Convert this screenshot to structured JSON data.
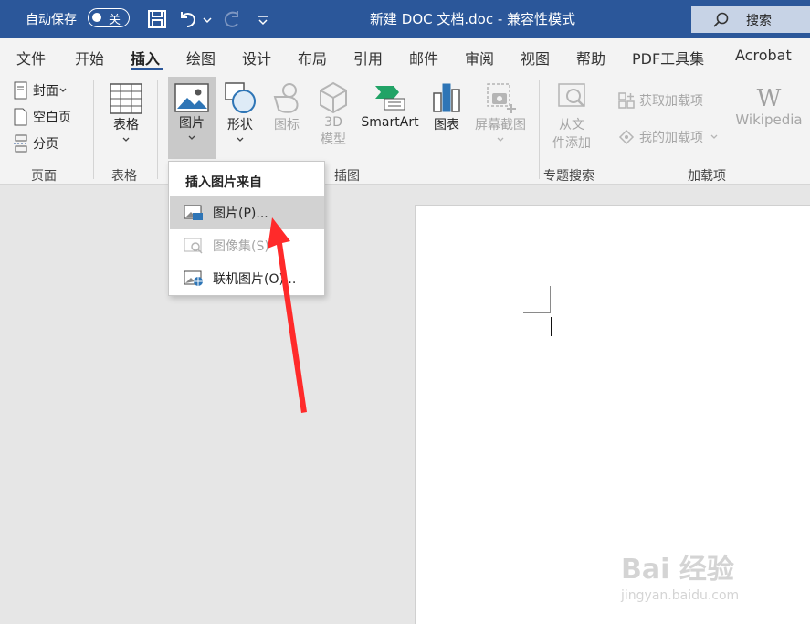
{
  "titlebar": {
    "autosave_label": "自动保存",
    "autosave_state": "关",
    "doc_title": "新建 DOC 文档.doc  -  兼容性模式",
    "search_label": "搜索"
  },
  "tabs": [
    "文件",
    "开始",
    "插入",
    "绘图",
    "设计",
    "布局",
    "引用",
    "邮件",
    "审阅",
    "视图",
    "帮助",
    "PDF工具集",
    "Acrobat"
  ],
  "active_tab": "插入",
  "ribbon": {
    "pages": {
      "cover": "封面",
      "blank": "空白页",
      "break": "分页",
      "group": "页面"
    },
    "table": {
      "label": "表格",
      "group": "表格"
    },
    "illustrations": {
      "picture": "图片",
      "shapes": "形状",
      "icons": "图标",
      "models3d_line1": "3D",
      "models3d_line2": "模型",
      "smartart": "SmartArt",
      "chart": "图表",
      "screenshot": "屏幕截图",
      "group": "插图"
    },
    "topic_search": {
      "line1": "从文",
      "line2": "件添加",
      "group": "专题搜索"
    },
    "addins": {
      "get": "获取加载项",
      "mine": "我的加载项",
      "wikipedia": "Wikipedia",
      "group": "加载项"
    }
  },
  "dropdown": {
    "header": "插入图片来自",
    "items": [
      {
        "label": "图片(P)...",
        "enabled": true
      },
      {
        "label": "图像集(S)",
        "enabled": false
      },
      {
        "label": "联机图片(O)...",
        "enabled": true
      }
    ]
  },
  "watermark": {
    "brand": "Bai 经验",
    "url": "jingyan.baidu.com"
  },
  "colors": {
    "accent": "#2b579a",
    "annotation_arrow": "#ff2a2a"
  }
}
